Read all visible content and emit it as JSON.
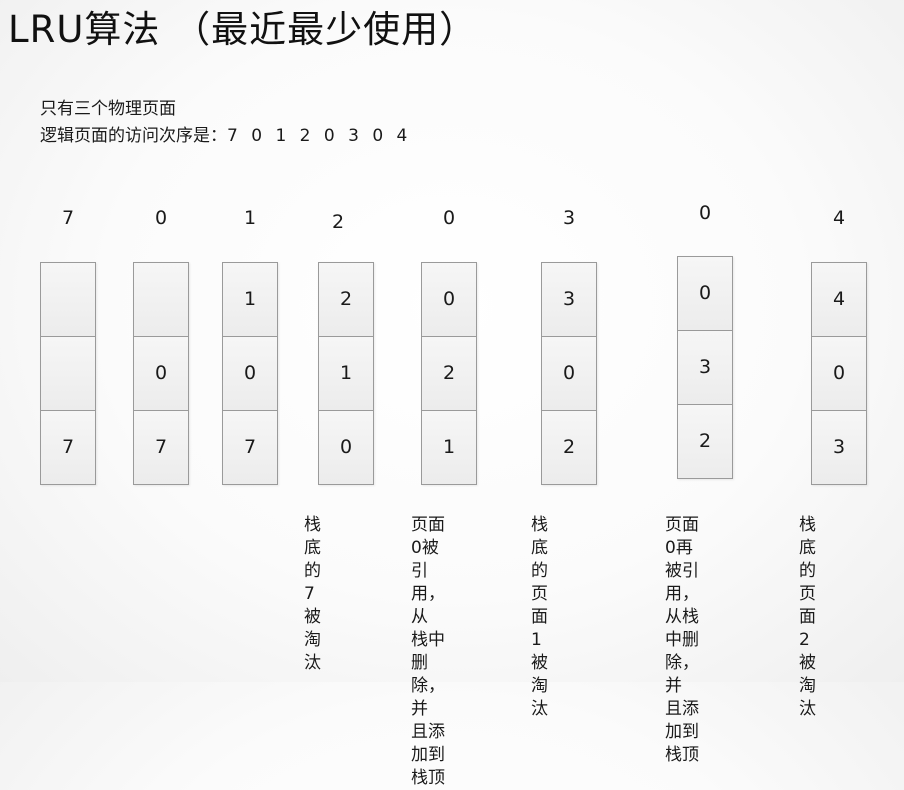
{
  "title": "LRU算法 （最近最少使用）",
  "intro": {
    "line1": "只有三个物理页面",
    "line2_prefix": "逻辑页面的访问次序是：",
    "sequence": "7 0 1 2 0 3 0 4"
  },
  "steps": [
    {
      "page": "7",
      "frames": [
        "",
        "",
        "7"
      ],
      "note": []
    },
    {
      "page": "0",
      "frames": [
        "",
        "0",
        "7"
      ],
      "note": []
    },
    {
      "page": "1",
      "frames": [
        "1",
        "0",
        "7"
      ],
      "note": []
    },
    {
      "page": "2",
      "frames": [
        "2",
        "1",
        "0"
      ],
      "note": [
        "栈底的7",
        "被淘汰"
      ]
    },
    {
      "page": "0",
      "frames": [
        "0",
        "2",
        "1"
      ],
      "note": [
        "页面0被",
        "引用，从",
        "栈中删",
        "除，并",
        "且添加到",
        "栈顶"
      ]
    },
    {
      "page": "3",
      "frames": [
        "3",
        "0",
        "2"
      ],
      "note": [
        "栈底的页",
        "面1被淘",
        "汰"
      ]
    },
    {
      "page": "0",
      "frames": [
        "0",
        "3",
        "2"
      ],
      "note": [
        "页面0再",
        "被引用，",
        "从栈中删",
        "除，并",
        "且添加到",
        "栈顶"
      ]
    },
    {
      "page": "4",
      "frames": [
        "4",
        "0",
        "3"
      ],
      "note": [
        "栈底的页",
        "面2被淘",
        "汰"
      ]
    }
  ]
}
